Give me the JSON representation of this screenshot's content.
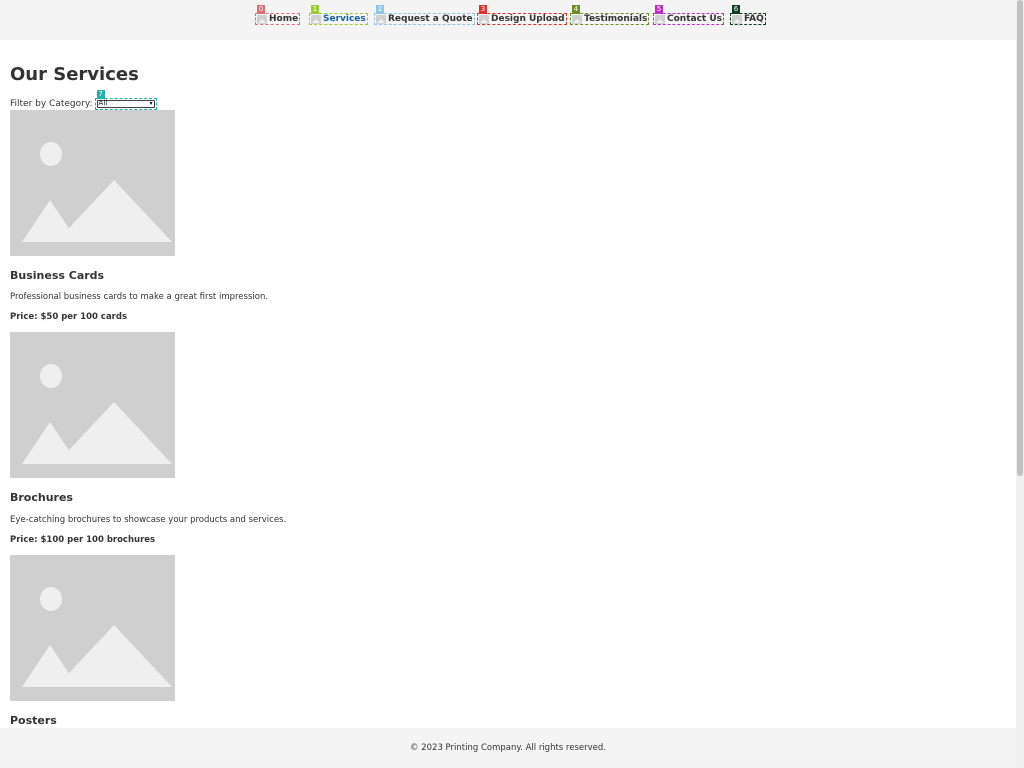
{
  "nav": {
    "items": [
      {
        "label": "Home",
        "tag": "0",
        "color": "#e06c75",
        "active": false
      },
      {
        "label": "Services",
        "tag": "1",
        "color": "#9acd32",
        "active": true
      },
      {
        "label": "Request a Quote",
        "tag": "2",
        "color": "#8ec5e8",
        "active": false
      },
      {
        "label": "Design Upload",
        "tag": "3",
        "color": "#e0302f",
        "active": false
      },
      {
        "label": "Testimonials",
        "tag": "4",
        "color": "#6b8e23",
        "active": false
      },
      {
        "label": "Contact Us",
        "tag": "5",
        "color": "#c030c0",
        "active": false
      },
      {
        "label": "FAQ",
        "tag": "6",
        "color": "#0a4020",
        "active": false
      }
    ]
  },
  "main": {
    "title": "Our Services",
    "filter": {
      "label": "Filter by Category:",
      "selected": "All",
      "tag": "7",
      "tag_color": "#20b2aa"
    }
  },
  "services": [
    {
      "name": "Business Cards",
      "description": "Professional business cards to make a great first impression.",
      "price": "Price: $50 per 100 cards"
    },
    {
      "name": "Brochures",
      "description": "Eye-catching brochures to showcase your products and services.",
      "price": "Price: $100 per 100 brochures"
    },
    {
      "name": "Posters",
      "description": "",
      "price": ""
    }
  ],
  "footer": {
    "text": "© 2023 Printing Company. All rights reserved."
  },
  "colors": {
    "header_bg": "#f4f4f4",
    "active_link": "#1a5fb4",
    "placeholder": "#cfcfcf"
  }
}
